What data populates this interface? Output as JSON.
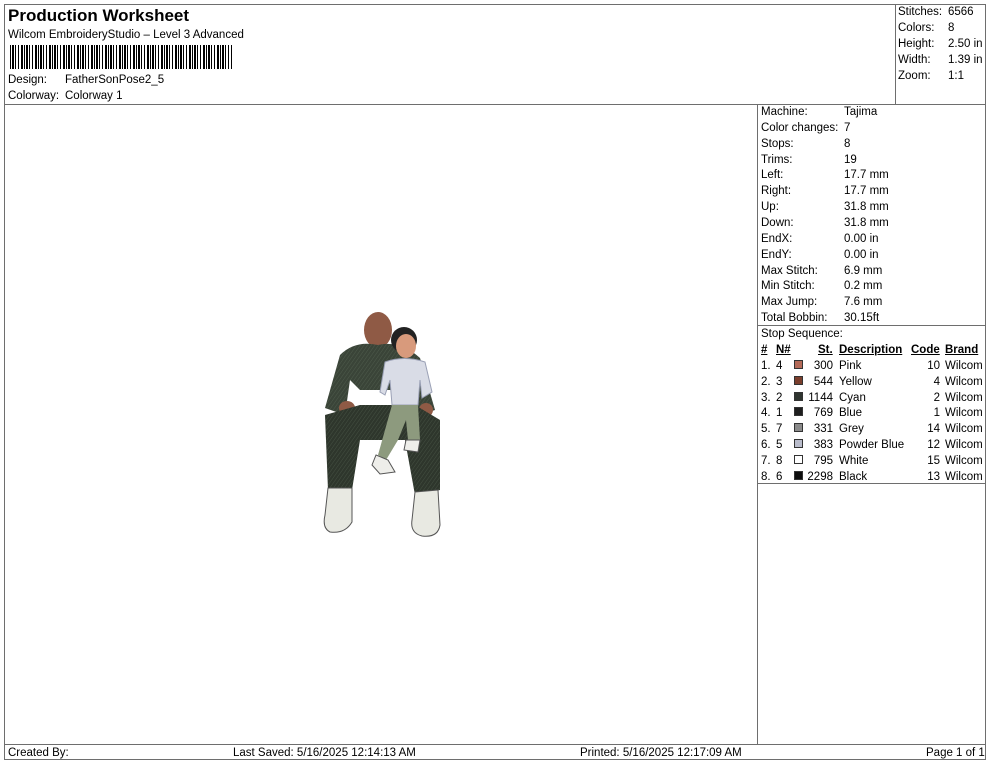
{
  "header": {
    "title": "Production Worksheet",
    "software": "Wilcom EmbroideryStudio – Level 3 Advanced",
    "design_label": "Design:",
    "design_value": "FatherSonPose2_5",
    "colorway_label": "Colorway:",
    "colorway_value": "Colorway 1"
  },
  "summary": [
    {
      "label": "Stitches:",
      "value": "6566"
    },
    {
      "label": "Colors:",
      "value": "8"
    },
    {
      "label": "Height:",
      "value": "2.50 in"
    },
    {
      "label": "Width:",
      "value": "1.39 in"
    },
    {
      "label": "Zoom:",
      "value": "1:1"
    }
  ],
  "machine_info": [
    {
      "label": "Machine:",
      "value": "Tajima"
    },
    {
      "label": "Color changes:",
      "value": "7"
    },
    {
      "label": "Stops:",
      "value": "8"
    },
    {
      "label": "Trims:",
      "value": "19"
    },
    {
      "label": "Left:",
      "value": "17.7 mm"
    },
    {
      "label": "Right:",
      "value": "17.7 mm"
    },
    {
      "label": "Up:",
      "value": "31.8 mm"
    },
    {
      "label": "Down:",
      "value": "31.8 mm"
    },
    {
      "label": "EndX:",
      "value": "0.00 in"
    },
    {
      "label": "EndY:",
      "value": "0.00 in"
    },
    {
      "label": "Max Stitch:",
      "value": "6.9 mm"
    },
    {
      "label": "Min Stitch:",
      "value": "0.2 mm"
    },
    {
      "label": "Max Jump:",
      "value": "7.6 mm"
    },
    {
      "label": "Total Bobbin:",
      "value": "30.15ft"
    }
  ],
  "stop_sequence": {
    "title": "Stop Sequence:",
    "headers": {
      "num": "#",
      "n": "N#",
      "st": "St.",
      "desc": "Description",
      "code": "Code",
      "brand": "Brand"
    },
    "rows": [
      {
        "num": "1.",
        "n": "4",
        "color": "#b46a58",
        "st": "300",
        "desc": "Pink",
        "code": "10",
        "brand": "Wilcom"
      },
      {
        "num": "2.",
        "n": "3",
        "color": "#7a3e2c",
        "st": "544",
        "desc": "Yellow",
        "code": "4",
        "brand": "Wilcom"
      },
      {
        "num": "3.",
        "n": "2",
        "color": "#2f3530",
        "st": "1144",
        "desc": "Cyan",
        "code": "2",
        "brand": "Wilcom"
      },
      {
        "num": "4.",
        "n": "1",
        "color": "#1e1e1e",
        "st": "769",
        "desc": "Blue",
        "code": "1",
        "brand": "Wilcom"
      },
      {
        "num": "5.",
        "n": "7",
        "color": "#8a8a8a",
        "st": "331",
        "desc": "Grey",
        "code": "14",
        "brand": "Wilcom"
      },
      {
        "num": "6.",
        "n": "5",
        "color": "#b9bccb",
        "st": "383",
        "desc": "Powder Blue",
        "code": "12",
        "brand": "Wilcom"
      },
      {
        "num": "7.",
        "n": "8",
        "color": "#ffffff",
        "st": "795",
        "desc": "White",
        "code": "15",
        "brand": "Wilcom"
      },
      {
        "num": "8.",
        "n": "6",
        "color": "#0d0d0d",
        "st": "2298",
        "desc": "Black",
        "code": "13",
        "brand": "Wilcom"
      }
    ]
  },
  "footer": {
    "created_by": "Created By:",
    "last_saved": "Last Saved: 5/16/2025 12:14:13 AM",
    "printed": "Printed: 5/16/2025 12:17:09 AM",
    "page": "Page 1 of 1"
  }
}
